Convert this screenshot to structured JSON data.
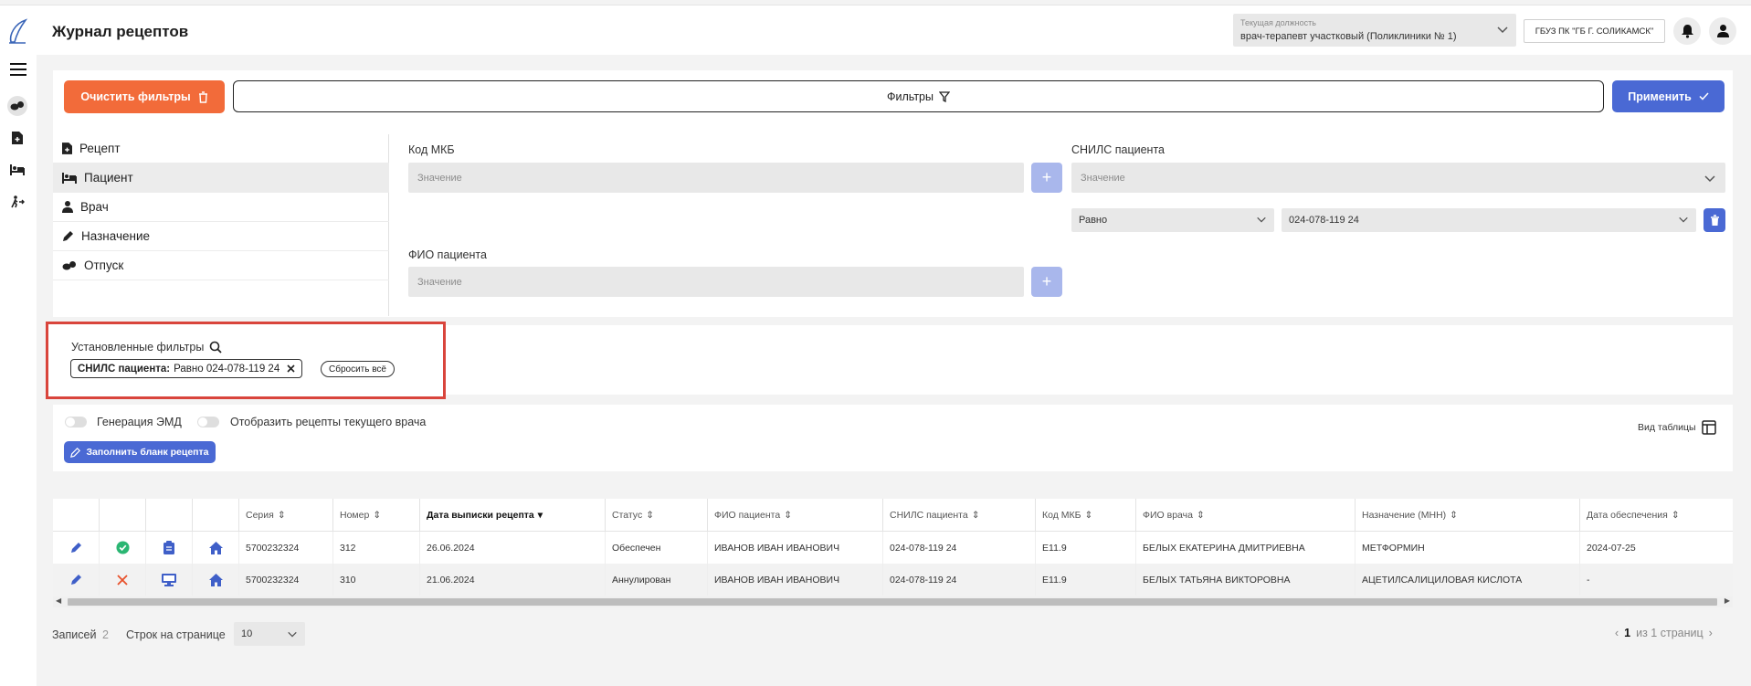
{
  "header": {
    "title": "Журнал рецептов",
    "position_label": "Текущая должность",
    "position_value": "врач-терапевт участковый (Поликлиники № 1)",
    "org": "ГБУЗ ПК \"ГБ Г. СОЛИКАМСК\""
  },
  "toolbar": {
    "clear_label": "Очистить фильтры",
    "filters_label": "Фильтры",
    "apply_label": "Применить"
  },
  "categories": [
    {
      "label": "Рецепт",
      "icon": "prescription-icon"
    },
    {
      "label": "Пациент",
      "icon": "patient-bed-icon"
    },
    {
      "label": "Врач",
      "icon": "doctor-icon"
    },
    {
      "label": "Назначение",
      "icon": "pen-icon"
    },
    {
      "label": "Отпуск",
      "icon": "pills-icon"
    }
  ],
  "fields": {
    "mkb_label": "Код МКБ",
    "mkb_placeholder": "Значение",
    "snils_label": "СНИЛС пациента",
    "snils_placeholder": "Значение",
    "condition_value": "Равно",
    "snils_value": "024-078-119 24",
    "fio_label": "ФИО пациента",
    "fio_placeholder": "Значение",
    "plus": "+"
  },
  "set_filters": {
    "title": "Установленные фильтры",
    "chip_field": "СНИЛС пациента:",
    "chip_value": "Равно 024-078-119 24",
    "reset_label": "Сбросить всё"
  },
  "options": {
    "emd_label": "Генерация ЭМД",
    "current_doctor_label": "Отобразить рецепты текущего врача",
    "fill_label": "Заполнить бланк рецепта",
    "view_table_label": "Вид таблицы"
  },
  "table": {
    "columns": [
      "Серия",
      "Номер",
      "Дата выписки рецепта",
      "Статус",
      "ФИО пациента",
      "СНИЛС пациента",
      "Код МКБ",
      "ФИО врача",
      "Назначение (МНН)",
      "Дата обеспечения"
    ],
    "rows": [
      {
        "status_icon": "check-circle-icon",
        "type_icon": "clipboard-icon",
        "series": "5700232324",
        "number": "312",
        "date": "26.06.2024",
        "status": "Обеспечен",
        "patient": "ИВАНОВ ИВАН ИВАНОВИЧ",
        "snils": "024-078-119 24",
        "mkb": "E11.9",
        "doctor": "БЕЛЫХ ЕКАТЕРИНА ДМИТРИЕВНА",
        "drug": "МЕТФОРМИН",
        "supply_date": "2024-07-25"
      },
      {
        "status_icon": "cross-icon",
        "type_icon": "monitor-icon",
        "series": "5700232324",
        "number": "310",
        "date": "21.06.2024",
        "status": "Аннулирован",
        "patient": "ИВАНОВ ИВАН ИВАНОВИЧ",
        "snils": "024-078-119 24",
        "mkb": "E11.9",
        "doctor": "БЕЛЫХ ТАТЬЯНА ВИКТОРОВНА",
        "drug": "АЦЕТИЛСАЛИЦИЛОВАЯ КИСЛОТА",
        "supply_date": "-"
      }
    ]
  },
  "footer": {
    "records_label": "Записей",
    "records_count": "2",
    "rows_label": "Строк на странице",
    "rows_value": "10",
    "page_current": "1",
    "page_of": "из 1 страниц"
  },
  "colors": {
    "accent": "#4a69d4",
    "danger": "#f26b3a",
    "highlight_border": "#d9453c",
    "success": "#2bb673"
  }
}
